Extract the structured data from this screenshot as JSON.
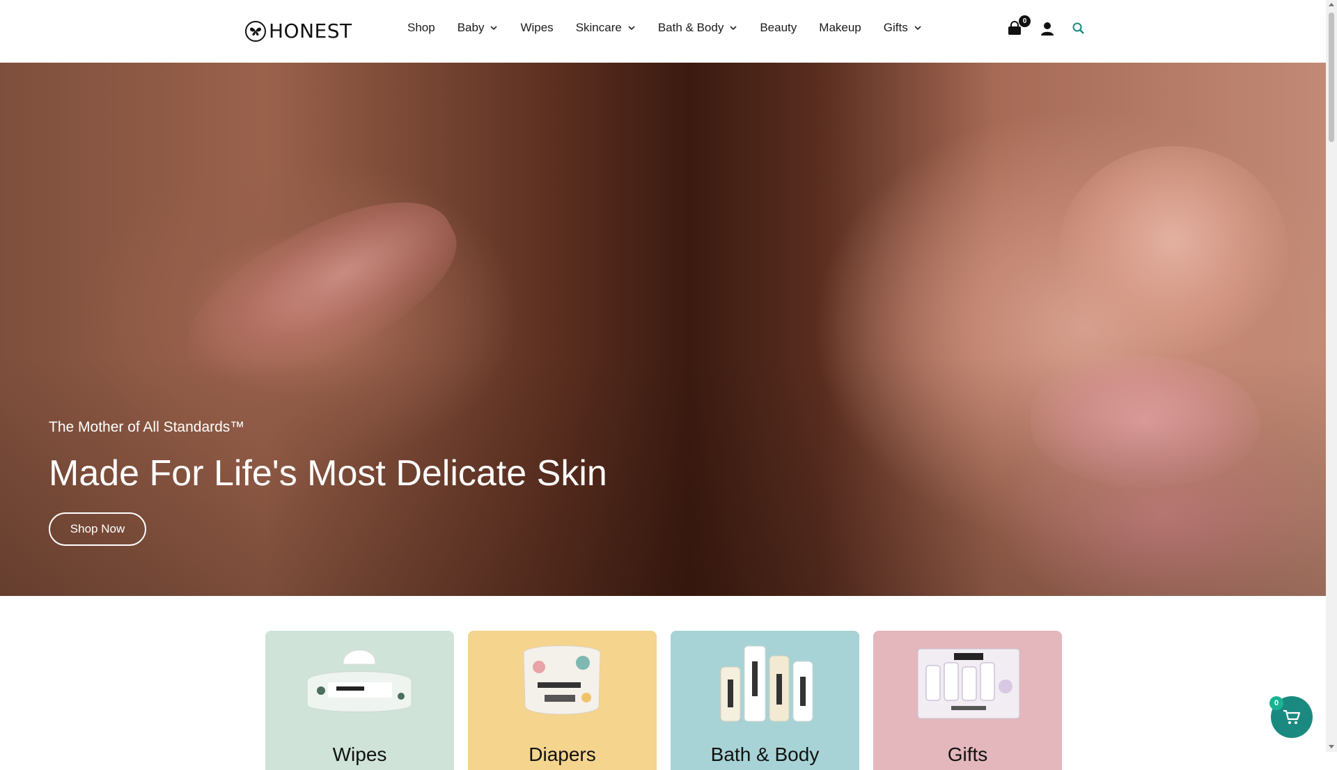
{
  "brand": {
    "name": "HONEST"
  },
  "nav": {
    "items": [
      {
        "label": "Shop",
        "has_dropdown": false
      },
      {
        "label": "Baby",
        "has_dropdown": true
      },
      {
        "label": "Wipes",
        "has_dropdown": false
      },
      {
        "label": "Skincare",
        "has_dropdown": true
      },
      {
        "label": "Bath & Body",
        "has_dropdown": true
      },
      {
        "label": "Beauty",
        "has_dropdown": false
      },
      {
        "label": "Makeup",
        "has_dropdown": false
      },
      {
        "label": "Gifts",
        "has_dropdown": true
      }
    ]
  },
  "header_icons": {
    "cart_count": "0",
    "cart_icon": "shopping-bag-icon",
    "account_icon": "user-icon",
    "search_icon": "search-icon",
    "search_color": "#1a8a80"
  },
  "hero": {
    "eyebrow": "The Mother of All Standards™",
    "title": "Made For Life's Most Delicate Skin",
    "cta_label": "Shop Now"
  },
  "categories": [
    {
      "label": "Wipes",
      "bg": "#cfe3d9"
    },
    {
      "label": "Diapers",
      "bg": "#f5d48e"
    },
    {
      "label": "Bath & Body",
      "bg": "#a7d3d6"
    },
    {
      "label": "Gifts",
      "bg": "#e3b7bb"
    }
  ],
  "chat_widget": {
    "count": "0",
    "icon": "cart-icon",
    "color": "#1a8a80"
  }
}
